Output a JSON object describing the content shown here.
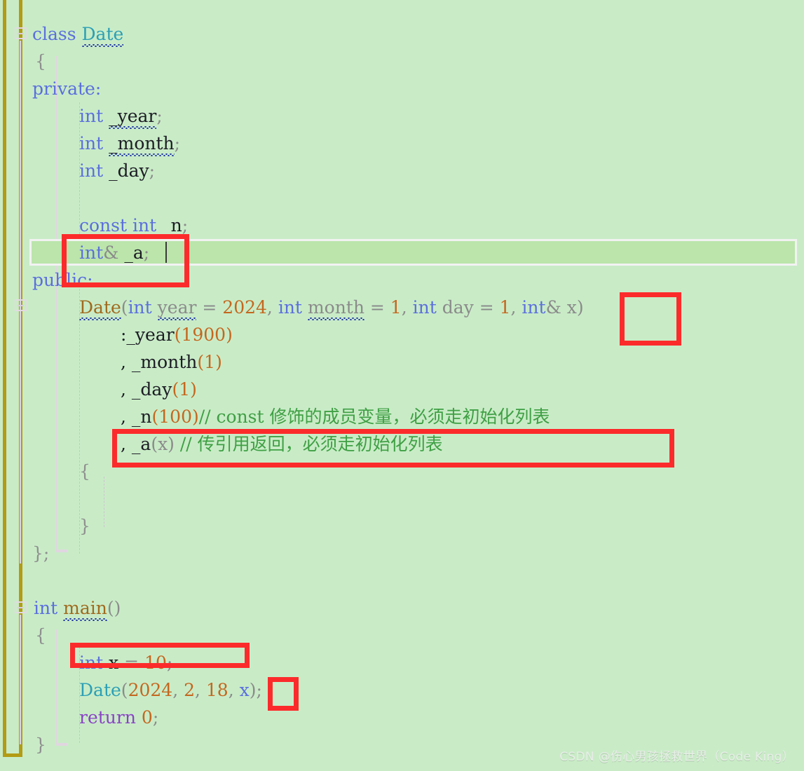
{
  "editor": {
    "background_color": "#c9ecc7",
    "current_line_color": "#bbe5ab",
    "annotation_color": "#fc2b2b",
    "change_bar_color": "#b39b14"
  },
  "code": {
    "l01_class": "class",
    "l01_name": "Date",
    "l02_brace": "{",
    "l03_private": "private:",
    "l04_int": "int",
    "l04_name": "_year",
    "l04_semi": ";",
    "l05_int": "int",
    "l05_name": "_month",
    "l05_semi": ";",
    "l06_int": "int",
    "l06_name": "_day",
    "l06_semi": ";",
    "l08_const": "const int",
    "l08_name": "_n",
    "l08_semi": ";",
    "l09_int": "int",
    "l09_amp": "&",
    "l09_name": "_a",
    "l09_semi": ";",
    "l10_public": "public:",
    "l11_fn": "Date",
    "l11_p1": "(",
    "l11_int1": "int",
    "l11_year": "year",
    "l11_eq1": " = ",
    "l11_2024": "2024",
    "l11_c1": ", ",
    "l11_int2": "int",
    "l11_month": "month",
    "l11_eq2": " = ",
    "l11_1a": "1",
    "l11_c2": ", ",
    "l11_int3": "int",
    "l11_day": " day",
    "l11_eq3": " = ",
    "l11_1b": "1",
    "l11_c3": ", ",
    "l11_int4": "int",
    "l11_amp": "&",
    "l11_x": " x",
    "l11_p2": ")",
    "l12_init": ":_year",
    "l12_val": "(1900)",
    "l13_init": ", _month",
    "l13_val": "(1)",
    "l14_init": ", _day",
    "l14_val": "(1)",
    "l15_init": ", _n",
    "l15_val": "(100)",
    "l15_comment": "// const 修饰的成员变量，必须走初始化列表",
    "l16_init": ", _a",
    "l16_val": "(x)",
    "l16_comment": " // 传引用返回，必须走初始化列表",
    "l17_brace": "{",
    "l19_brace": "}",
    "l20_end": "};",
    "l22_int": "int",
    "l22_main": "main",
    "l22_parens": "()",
    "l23_brace": "{",
    "l24_int": "int",
    "l24_x": " x ",
    "l24_eq": "= ",
    "l24_10": "10",
    "l24_semi": ";",
    "l25_date": "Date",
    "l25_open": "(",
    "l25_2024": "2024",
    "l25_c1": ", ",
    "l25_2": "2",
    "l25_c2": ", ",
    "l25_18": "18",
    "l25_c3": ", ",
    "l25_x": "x",
    "l25_close": ")",
    "l25_semi": ";",
    "l26_return": "return",
    "l26_zero": " 0",
    "l26_semi": ";",
    "l27_brace": "}"
  },
  "watermark": {
    "text": "CSDN @伤心男孩拯救世界（Code King）"
  }
}
